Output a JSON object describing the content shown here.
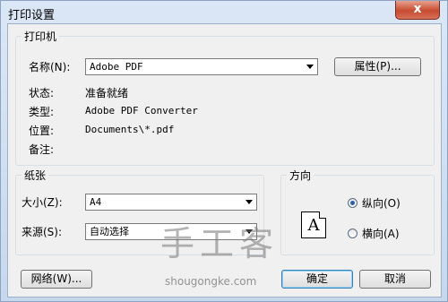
{
  "window": {
    "title": "打印设置",
    "close_label": "x"
  },
  "printer": {
    "group_label": "打印机",
    "name_label": "名称(N):",
    "name_value": "Adobe PDF",
    "properties_button": "属性(P)...",
    "status_label": "状态:",
    "status_value": "准备就绪",
    "type_label": "类型:",
    "type_value": "Adobe PDF Converter",
    "location_label": "位置:",
    "location_value": "Documents\\*.pdf",
    "comment_label": "备注:",
    "comment_value": ""
  },
  "paper": {
    "group_label": "纸张",
    "size_label": "大小(Z):",
    "size_value": "A4",
    "source_label": "来源(S):",
    "source_value": "自动选择"
  },
  "orientation": {
    "group_label": "方向",
    "page_letter": "A",
    "portrait_label": "纵向(O)",
    "landscape_label": "横向(A)",
    "selected": "portrait"
  },
  "buttons": {
    "network": "网络(W)...",
    "ok": "确定",
    "cancel": "取消"
  },
  "watermark": {
    "text": "手工客",
    "url": "shougongke.com"
  }
}
